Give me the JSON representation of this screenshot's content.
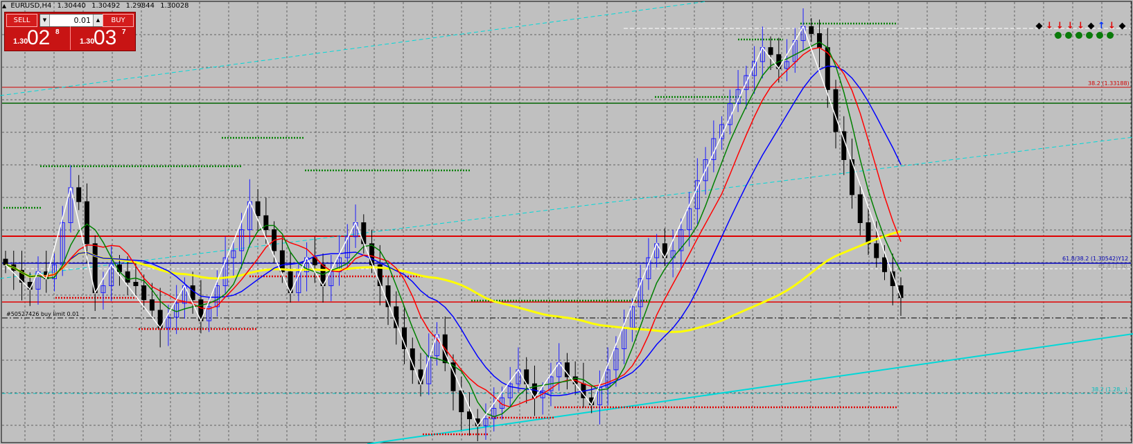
{
  "window": {
    "symbol": "EURUSD,H4",
    "ohlc": [
      "1.30440",
      "1.30492",
      "1.29844",
      "1.30028"
    ]
  },
  "trade_panel": {
    "sell_label": "SELL",
    "buy_label": "BUY",
    "lot_value": "0.01",
    "sell_quote": {
      "prefix": "1.30",
      "big": "02",
      "pip": "8"
    },
    "buy_quote": {
      "prefix": "1.30",
      "big": "03",
      "pip": "7"
    }
  },
  "signals": {
    "arrows": [
      {
        "dir": "diamond",
        "color": "#000000"
      },
      {
        "dir": "down",
        "color": "#e00000"
      },
      {
        "dir": "down",
        "color": "#e00000"
      },
      {
        "dir": "down",
        "color": "#e00000"
      },
      {
        "dir": "down",
        "color": "#e00000"
      },
      {
        "dir": "diamond",
        "color": "#000000"
      },
      {
        "dir": "up",
        "color": "#0030ff"
      },
      {
        "dir": "down",
        "color": "#e00000"
      },
      {
        "dir": "diamond",
        "color": "#000000"
      }
    ],
    "dot_count": 6,
    "dot_color": "#0a7a0a"
  },
  "labels": {
    "fib_382": "38.2 (1.33188)",
    "fib_618": "61.8/38.2 (1.30542)Y12",
    "fib_618_sub": "61.8 (1.30...)",
    "fib_low": "38.2 (1.28...)",
    "order": "#50527426 buy limit 0.01"
  },
  "colors": {
    "background": "#c0c0c0",
    "grid": "#606060",
    "bull_candle": "#1a1aff",
    "bear_candle": "#000000",
    "ma_fast": "#008000",
    "ma_mid": "#ff0000",
    "ma_slow": "#0000ff",
    "ma_long": "#ffff00",
    "zigzag": "#ffffff",
    "zigzag_inner": "#00e0e0",
    "support": "#ff0000",
    "resistance": "#008000",
    "trendline": "#00e0e0"
  },
  "chart_data": {
    "type": "candlestick",
    "series": [
      {
        "name": "",
        "close": [
          1.305,
          1.3042,
          1.3025,
          1.3015,
          1.304,
          1.303,
          1.305,
          1.311,
          1.316,
          1.314,
          1.308,
          1.301,
          1.302,
          1.305,
          1.304,
          1.3025,
          1.302,
          1.3,
          1.2985,
          1.296,
          1.2975,
          1.2995,
          1.302,
          1.3,
          1.297,
          1.299,
          1.302,
          1.306,
          1.307,
          1.31,
          1.314,
          1.312,
          1.31,
          1.307,
          1.304,
          1.301,
          1.304,
          1.306,
          1.305,
          1.302,
          1.304,
          1.306,
          1.309,
          1.311,
          1.308,
          1.305,
          1.302,
          1.299,
          1.296,
          1.293,
          1.29,
          1.288,
          1.292,
          1.295,
          1.291,
          1.287,
          1.284,
          1.283,
          1.282,
          1.283,
          1.2845,
          1.286,
          1.288,
          1.29,
          1.288,
          1.286,
          1.287,
          1.289,
          1.291,
          1.289,
          1.288,
          1.286,
          1.285,
          1.2875,
          1.29,
          1.293,
          1.296,
          1.299,
          1.303,
          1.306,
          1.308,
          1.306,
          1.307,
          1.31,
          1.313,
          1.317,
          1.32,
          1.323,
          1.325,
          1.328,
          1.33,
          1.332,
          1.334,
          1.336,
          1.335,
          1.333,
          1.334,
          1.337,
          1.339,
          1.338,
          1.336,
          1.33,
          1.324,
          1.32,
          1.315,
          1.311,
          1.308,
          1.306,
          1.304,
          1.302,
          1.3003
        ]
      }
    ],
    "ylim": [
      1.28,
      1.342
    ],
    "grid": true,
    "horizontal_levels": [
      1.33188,
      1.30542
    ]
  }
}
